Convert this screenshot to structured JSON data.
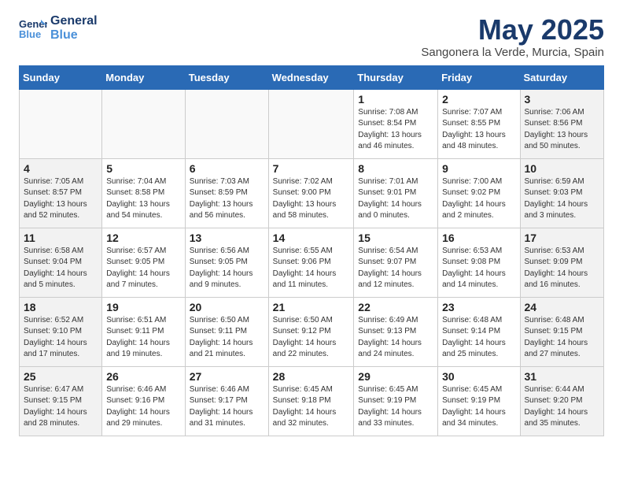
{
  "header": {
    "logo_line1": "General",
    "logo_line2": "Blue",
    "month_title": "May 2025",
    "location": "Sangonera la Verde, Murcia, Spain"
  },
  "days_of_week": [
    "Sunday",
    "Monday",
    "Tuesday",
    "Wednesday",
    "Thursday",
    "Friday",
    "Saturday"
  ],
  "weeks": [
    [
      {
        "day": "",
        "info": ""
      },
      {
        "day": "",
        "info": ""
      },
      {
        "day": "",
        "info": ""
      },
      {
        "day": "",
        "info": ""
      },
      {
        "day": "1",
        "info": "Sunrise: 7:08 AM\nSunset: 8:54 PM\nDaylight: 13 hours\nand 46 minutes."
      },
      {
        "day": "2",
        "info": "Sunrise: 7:07 AM\nSunset: 8:55 PM\nDaylight: 13 hours\nand 48 minutes."
      },
      {
        "day": "3",
        "info": "Sunrise: 7:06 AM\nSunset: 8:56 PM\nDaylight: 13 hours\nand 50 minutes."
      }
    ],
    [
      {
        "day": "4",
        "info": "Sunrise: 7:05 AM\nSunset: 8:57 PM\nDaylight: 13 hours\nand 52 minutes."
      },
      {
        "day": "5",
        "info": "Sunrise: 7:04 AM\nSunset: 8:58 PM\nDaylight: 13 hours\nand 54 minutes."
      },
      {
        "day": "6",
        "info": "Sunrise: 7:03 AM\nSunset: 8:59 PM\nDaylight: 13 hours\nand 56 minutes."
      },
      {
        "day": "7",
        "info": "Sunrise: 7:02 AM\nSunset: 9:00 PM\nDaylight: 13 hours\nand 58 minutes."
      },
      {
        "day": "8",
        "info": "Sunrise: 7:01 AM\nSunset: 9:01 PM\nDaylight: 14 hours\nand 0 minutes."
      },
      {
        "day": "9",
        "info": "Sunrise: 7:00 AM\nSunset: 9:02 PM\nDaylight: 14 hours\nand 2 minutes."
      },
      {
        "day": "10",
        "info": "Sunrise: 6:59 AM\nSunset: 9:03 PM\nDaylight: 14 hours\nand 3 minutes."
      }
    ],
    [
      {
        "day": "11",
        "info": "Sunrise: 6:58 AM\nSunset: 9:04 PM\nDaylight: 14 hours\nand 5 minutes."
      },
      {
        "day": "12",
        "info": "Sunrise: 6:57 AM\nSunset: 9:05 PM\nDaylight: 14 hours\nand 7 minutes."
      },
      {
        "day": "13",
        "info": "Sunrise: 6:56 AM\nSunset: 9:05 PM\nDaylight: 14 hours\nand 9 minutes."
      },
      {
        "day": "14",
        "info": "Sunrise: 6:55 AM\nSunset: 9:06 PM\nDaylight: 14 hours\nand 11 minutes."
      },
      {
        "day": "15",
        "info": "Sunrise: 6:54 AM\nSunset: 9:07 PM\nDaylight: 14 hours\nand 12 minutes."
      },
      {
        "day": "16",
        "info": "Sunrise: 6:53 AM\nSunset: 9:08 PM\nDaylight: 14 hours\nand 14 minutes."
      },
      {
        "day": "17",
        "info": "Sunrise: 6:53 AM\nSunset: 9:09 PM\nDaylight: 14 hours\nand 16 minutes."
      }
    ],
    [
      {
        "day": "18",
        "info": "Sunrise: 6:52 AM\nSunset: 9:10 PM\nDaylight: 14 hours\nand 17 minutes."
      },
      {
        "day": "19",
        "info": "Sunrise: 6:51 AM\nSunset: 9:11 PM\nDaylight: 14 hours\nand 19 minutes."
      },
      {
        "day": "20",
        "info": "Sunrise: 6:50 AM\nSunset: 9:11 PM\nDaylight: 14 hours\nand 21 minutes."
      },
      {
        "day": "21",
        "info": "Sunrise: 6:50 AM\nSunset: 9:12 PM\nDaylight: 14 hours\nand 22 minutes."
      },
      {
        "day": "22",
        "info": "Sunrise: 6:49 AM\nSunset: 9:13 PM\nDaylight: 14 hours\nand 24 minutes."
      },
      {
        "day": "23",
        "info": "Sunrise: 6:48 AM\nSunset: 9:14 PM\nDaylight: 14 hours\nand 25 minutes."
      },
      {
        "day": "24",
        "info": "Sunrise: 6:48 AM\nSunset: 9:15 PM\nDaylight: 14 hours\nand 27 minutes."
      }
    ],
    [
      {
        "day": "25",
        "info": "Sunrise: 6:47 AM\nSunset: 9:15 PM\nDaylight: 14 hours\nand 28 minutes."
      },
      {
        "day": "26",
        "info": "Sunrise: 6:46 AM\nSunset: 9:16 PM\nDaylight: 14 hours\nand 29 minutes."
      },
      {
        "day": "27",
        "info": "Sunrise: 6:46 AM\nSunset: 9:17 PM\nDaylight: 14 hours\nand 31 minutes."
      },
      {
        "day": "28",
        "info": "Sunrise: 6:45 AM\nSunset: 9:18 PM\nDaylight: 14 hours\nand 32 minutes."
      },
      {
        "day": "29",
        "info": "Sunrise: 6:45 AM\nSunset: 9:19 PM\nDaylight: 14 hours\nand 33 minutes."
      },
      {
        "day": "30",
        "info": "Sunrise: 6:45 AM\nSunset: 9:19 PM\nDaylight: 14 hours\nand 34 minutes."
      },
      {
        "day": "31",
        "info": "Sunrise: 6:44 AM\nSunset: 9:20 PM\nDaylight: 14 hours\nand 35 minutes."
      }
    ]
  ]
}
